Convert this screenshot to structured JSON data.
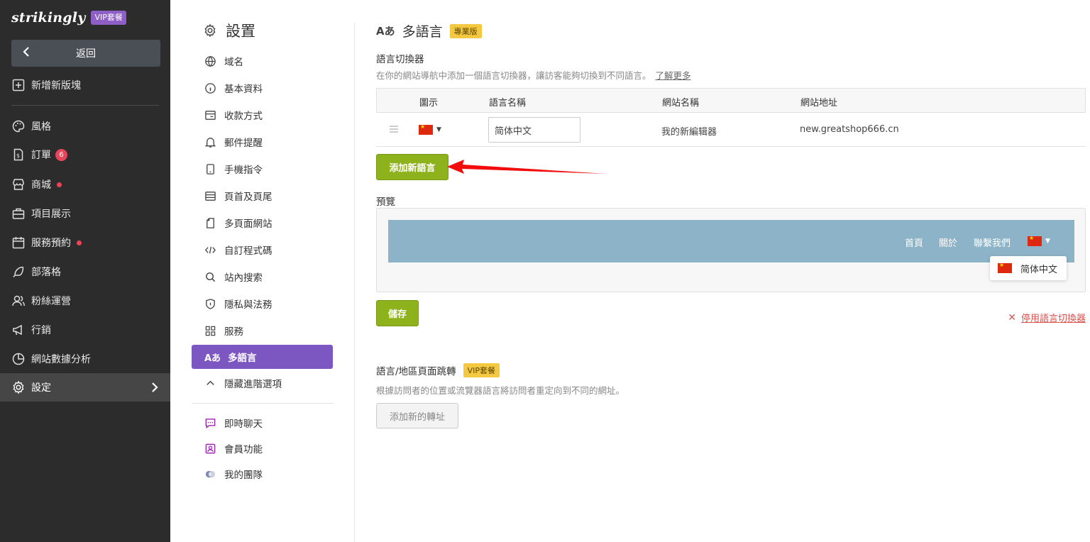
{
  "app": {
    "logo": "strikingly",
    "plan_badge": "VIP套餐"
  },
  "sidebar": {
    "back_label": "返回",
    "add_section_label": "新增新版塊",
    "items": [
      {
        "label": "風格",
        "icon": "palette-icon"
      },
      {
        "label": "訂單",
        "icon": "receipt-icon",
        "badge": "6"
      },
      {
        "label": "商城",
        "icon": "store-icon",
        "dot": true
      },
      {
        "label": "項目展示",
        "icon": "briefcase-icon"
      },
      {
        "label": "服務預約",
        "icon": "calendar-icon",
        "dot": true
      },
      {
        "label": "部落格",
        "icon": "feather-icon"
      },
      {
        "label": "粉絲運營",
        "icon": "users-icon"
      },
      {
        "label": "行銷",
        "icon": "megaphone-icon"
      },
      {
        "label": "網站數據分析",
        "icon": "pie-chart-icon"
      },
      {
        "label": "設定",
        "icon": "gear-icon",
        "active": true
      }
    ]
  },
  "settings_nav": {
    "title": "設置",
    "items": [
      {
        "label": "域名",
        "icon": "globe-icon"
      },
      {
        "label": "基本資料",
        "icon": "info-icon"
      },
      {
        "label": "收款方式",
        "icon": "wallet-icon"
      },
      {
        "label": "郵件提醒",
        "icon": "bell-icon"
      },
      {
        "label": "手機指令",
        "icon": "phone-icon"
      },
      {
        "label": "頁首及頁尾",
        "icon": "layout-icon"
      },
      {
        "label": "多頁面網站",
        "icon": "pages-icon"
      },
      {
        "label": "自訂程式碼",
        "icon": "code-icon"
      },
      {
        "label": "站內搜索",
        "icon": "search-icon"
      },
      {
        "label": "隱私與法務",
        "icon": "shield-icon"
      },
      {
        "label": "服務",
        "icon": "grid-icon"
      },
      {
        "label": "多語言",
        "icon": "language-icon",
        "active": true
      },
      {
        "label": "隱藏進階選項",
        "icon": "chevron-up-icon"
      }
    ],
    "extras": [
      {
        "label": "即時聊天",
        "icon": "chat-icon"
      },
      {
        "label": "會員功能",
        "icon": "member-icon"
      },
      {
        "label": "我的團隊",
        "icon": "team-icon"
      }
    ]
  },
  "main": {
    "icon_text": "Aあ",
    "title": "多語言",
    "title_badge": "專業版",
    "switcher": {
      "label": "語言切換器",
      "description": "在你的網站導航中添加一個語言切換器，讓訪客能夠切換到不同語言。",
      "learn_more": "了解更多"
    },
    "table": {
      "headers": [
        "圖示",
        "語言名稱",
        "網站名稱",
        "網站地址"
      ],
      "rows": [
        {
          "flag": "cn-flag",
          "language_name": "简体中文",
          "site_name": "我的新編辑器",
          "site_url": "new.greatshop666.cn"
        }
      ]
    },
    "add_language_button": "添加新語言",
    "preview": {
      "label": "預覽",
      "nav_links": [
        "首頁",
        "關於",
        "聯繫我們"
      ],
      "dropdown_option": "简体中文",
      "nav_color": "#8cb3c7"
    },
    "save_button": "儲存",
    "disable_link": "停用語言切換器",
    "redirect": {
      "label": "語言/地區頁面跳轉",
      "badge": "VIP套餐",
      "description": "根據訪問者的位置或流覽器語言將訪問者重定向到不同的網址。",
      "add_button": "添加新的轉址"
    }
  },
  "colors": {
    "accent_purple": "#7c57c2",
    "button_green": "#8eb21c",
    "badge_yellow": "#f5c842",
    "danger_red": "#d9534f"
  }
}
